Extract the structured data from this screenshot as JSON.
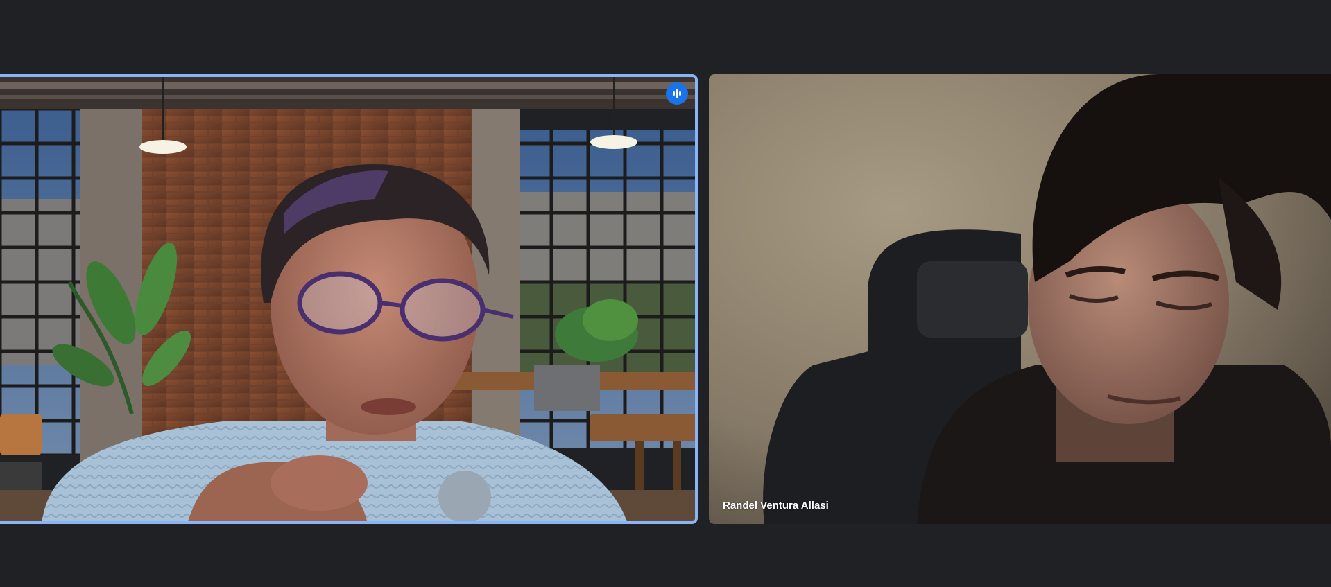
{
  "participants": [
    {
      "name": "",
      "speaking": true,
      "speaking_indicator_icon": "audio-level-icon",
      "accent_color": "#8ab4f8"
    },
    {
      "name": "Randel Ventura Allasi",
      "speaking": false
    }
  ],
  "colors": {
    "background": "#202124",
    "active_border": "#8ab4f8",
    "badge": "#1a73e8"
  }
}
